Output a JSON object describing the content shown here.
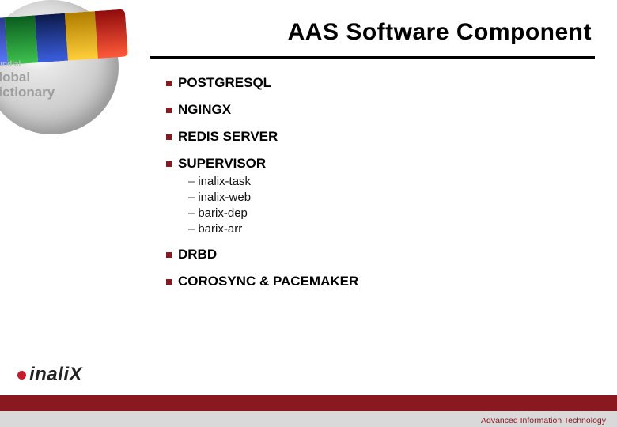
{
  "title": "AAS Software Component",
  "items": [
    {
      "label": "POSTGRESQL"
    },
    {
      "label": "NGINGX"
    },
    {
      "label": "REDIS SERVER"
    },
    {
      "label": "SUPERVISOR",
      "sub": [
        "inalix-task",
        "inalix-web",
        "barix-dep",
        "barix-arr"
      ]
    },
    {
      "label": "DRBD"
    },
    {
      "label": "COROSYNC & PACEMAKER"
    }
  ],
  "decor": {
    "wc1": "global",
    "wc2": "mundial",
    "wc3": "dictionary"
  },
  "footer": {
    "logo": "inaliX",
    "tagline": "Advanced Information Technology"
  }
}
